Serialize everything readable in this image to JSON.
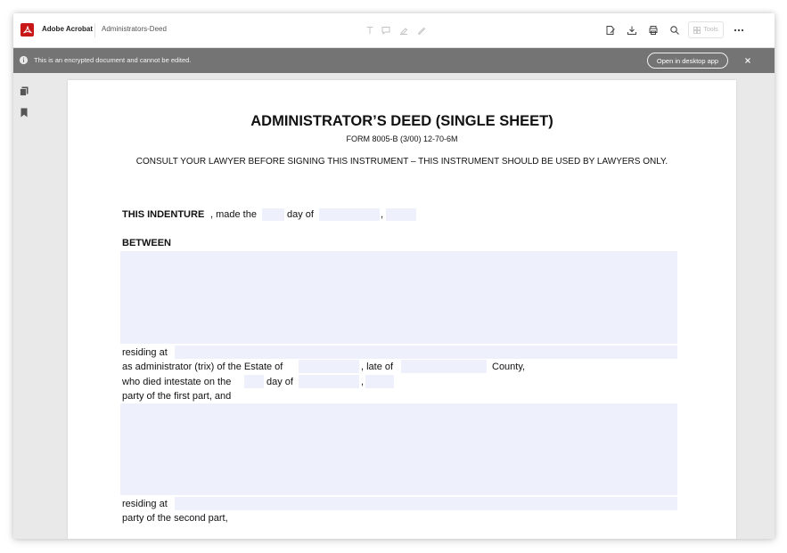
{
  "app": {
    "name": "Adobe Acrobat",
    "document_name": "Administrators-Deed"
  },
  "toolbar": {
    "tools_label": "Tools",
    "annotation_icons": [
      "text-tool-icon",
      "comment-icon",
      "highlight-icon",
      "draw-icon"
    ],
    "action_icons": [
      "edit-sign-icon",
      "download-icon",
      "print-icon",
      "search-icon",
      "more-icon"
    ]
  },
  "notice": {
    "message": "This is an encrypted document and cannot be edited.",
    "open_desktop_label": "Open in desktop app",
    "close_symbol": "×"
  },
  "colors": {
    "brand": "#c81717",
    "notice_bg": "#747474",
    "field_fill": "#eef1fb",
    "window_bg": "#e9e9e9"
  },
  "document": {
    "title": "ADMINISTRATOR’S DEED (SINGLE SHEET)",
    "form_number": "FORM 8005-B (3/00) 12-70-6M",
    "consult": "CONSULT YOUR LAWYER BEFORE SIGNING THIS INSTRUMENT – THIS INSTRUMENT SHOULD BE USED BY LAWYERS ONLY.",
    "indenture_bold": "THIS INDENTURE",
    "indenture_made": ", made the",
    "day_of": "day of",
    "comma": ",",
    "between": "BETWEEN",
    "residing_at": "residing at",
    "as_administrator": "as administrator (trix) of the Estate of",
    "late_of": ", late of",
    "county": "County,",
    "died_intestate": "who died intestate on the",
    "day_of_2": "day of",
    "comma_2": ",",
    "first_part": "party of the first part, and",
    "residing_at_2": "residing at",
    "second_part": "party of the second part,"
  }
}
